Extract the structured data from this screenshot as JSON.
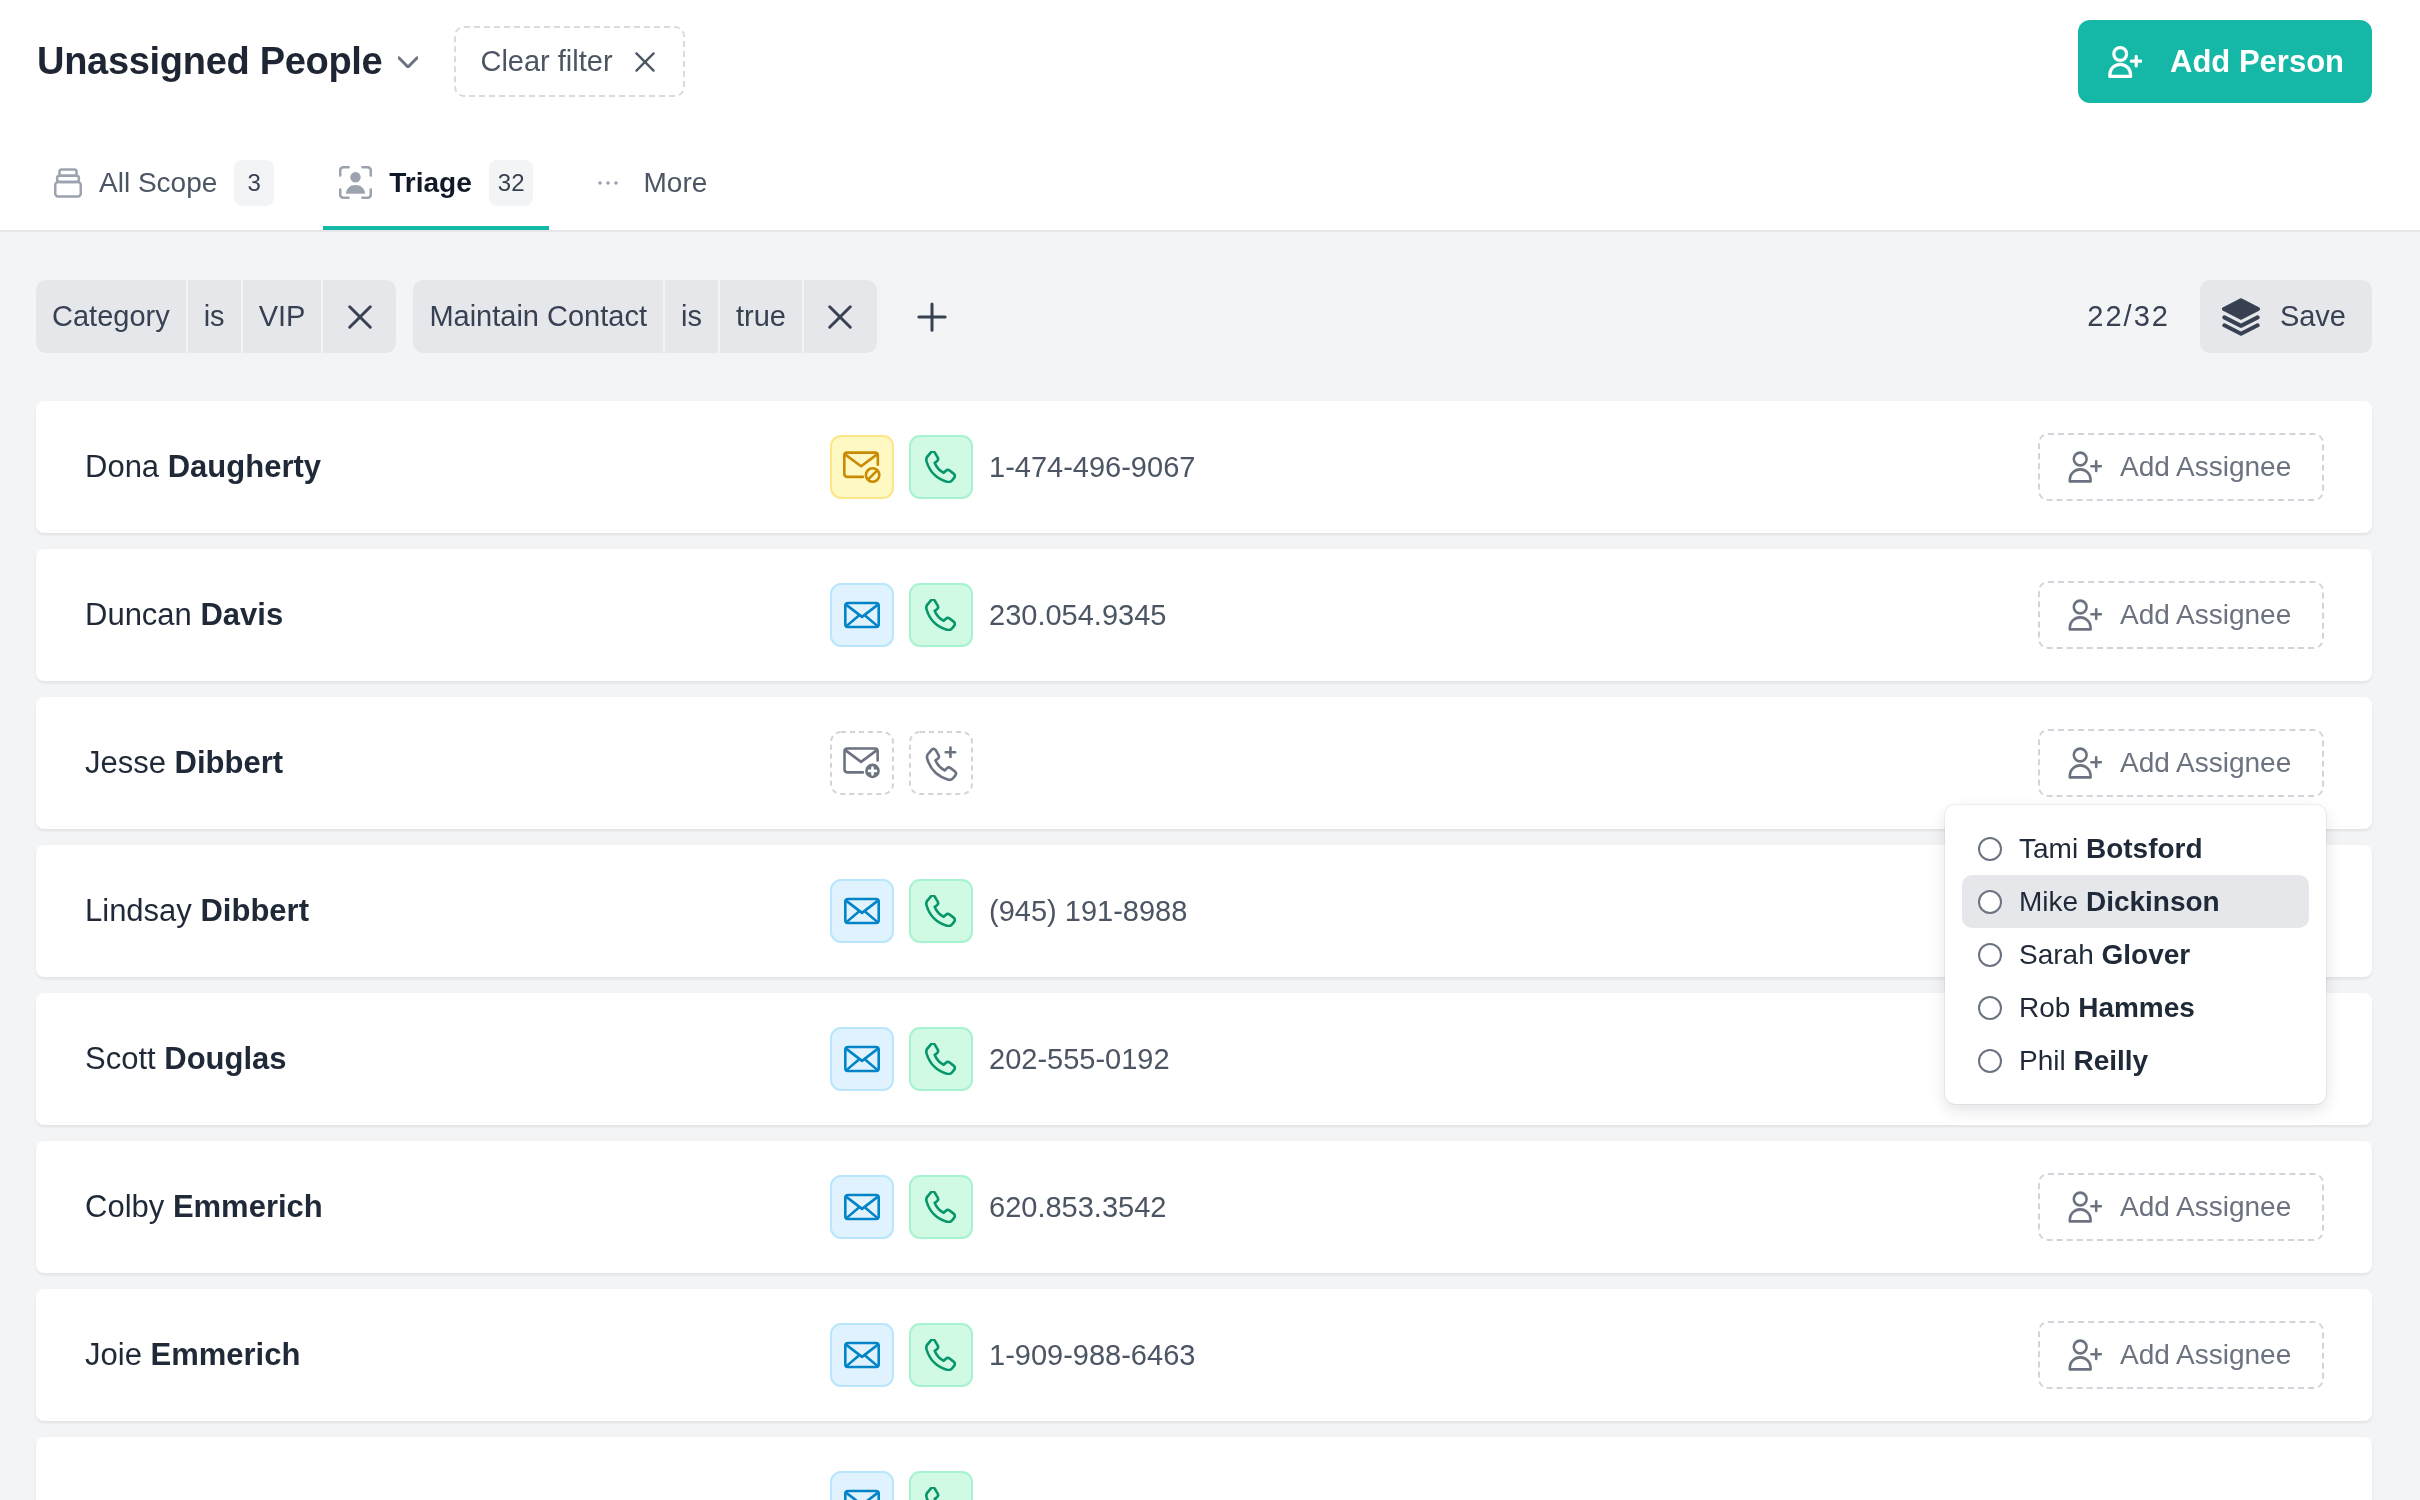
{
  "header": {
    "title": "Unassigned People",
    "clear_filter": "Clear filter",
    "add_button": "Add Person"
  },
  "tabs": [
    {
      "label": "All Scope",
      "count": "3",
      "selected": false
    },
    {
      "label": "Triage",
      "count": "32",
      "selected": true
    },
    {
      "label": "More",
      "selected": false
    }
  ],
  "filters": [
    {
      "field": "Category",
      "operator": "is",
      "value": "VIP"
    },
    {
      "field": "Maintain Contact",
      "operator": "is",
      "value": "true"
    }
  ],
  "result_count": "22/32",
  "save_button": "Save",
  "rows": [
    {
      "name": "Dona **Daugherty**",
      "has_email": true,
      "email_opted_out": true,
      "has_phone": true,
      "phone": "1-474-496-9067",
      "assign_label": "Add Assignee"
    },
    {
      "name": "Duncan **Davis**",
      "has_email": true,
      "email_opted_out": false,
      "has_phone": true,
      "phone": "230.054.9345",
      "assign_label": "Add Assignee"
    },
    {
      "name": "Jesse **Dibbert**",
      "has_email": false,
      "email_opted_out": false,
      "has_phone": false,
      "assign_label": "Add Assignee",
      "menu": [
        {
          "name": "Tami **Botsford**",
          "selected": false,
          "highlighted": false
        },
        {
          "name": "Mike **Dickinson**",
          "selected": false,
          "highlighted": true
        },
        {
          "name": "Sarah **Glover**",
          "selected": false,
          "highlighted": false
        },
        {
          "name": "Rob **Hammes**",
          "selected": false,
          "highlighted": false
        },
        {
          "name": "Phil **Reilly**",
          "selected": false,
          "highlighted": false
        }
      ]
    },
    {
      "name": "Lindsay **Dibbert**",
      "has_email": true,
      "email_opted_out": false,
      "has_phone": true,
      "phone": "(945) 191-8988"
    },
    {
      "name": "Scott **Douglas**",
      "has_email": true,
      "email_opted_out": false,
      "has_phone": true,
      "phone": "202-555-0192"
    },
    {
      "name": "Colby **Emmerich**",
      "has_email": true,
      "email_opted_out": false,
      "has_phone": true,
      "phone": "620.853.3542",
      "assign_label": "Add Assignee"
    },
    {
      "name": "Joie **Emmerich**",
      "has_email": true,
      "email_opted_out": false,
      "has_phone": true,
      "phone": "1-909-988-6463",
      "assign_label": "Add Assignee"
    },
    {
      "has_email": true,
      "email_opted_out": false,
      "has_phone": true
    }
  ]
}
